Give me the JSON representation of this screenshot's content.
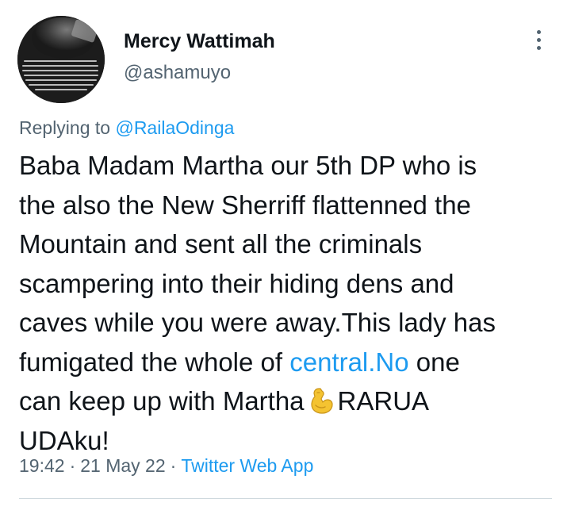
{
  "user": {
    "name": "Mercy Wattimah",
    "handle": "@ashamuyo"
  },
  "reply": {
    "prefix": "Replying to ",
    "mention": "@RailaOdinga"
  },
  "tweet": {
    "lines": [
      "Baba Madam Martha our 5th DP who is",
      "the also the New Sherriff flattenned the",
      "Mountain and sent all the criminals",
      "scampering into their hiding dens and",
      "caves while you were away.This lady has"
    ],
    "line6_before": "fumigated the whole of ",
    "line6_link": "central.No",
    "line6_after": " one",
    "line7_before": "can keep up with Martha",
    "line7_emoji": "flexed-biceps-emoji",
    "line7_after": "RARUA",
    "line8": "UDAku!"
  },
  "meta": {
    "time": "19:42",
    "separator": "·",
    "date": "21 May 22",
    "source": "Twitter Web App"
  },
  "icons": {
    "more": "more-options-icon",
    "avatar": "avatar-image"
  },
  "colors": {
    "text": "#0f1419",
    "secondary": "#536471",
    "link": "#1d9bf0",
    "divider": "#cfd9de"
  }
}
